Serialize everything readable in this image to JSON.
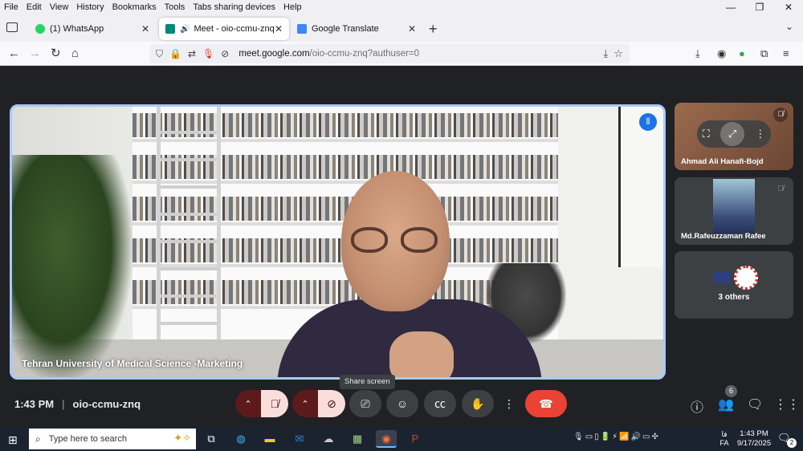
{
  "browser": {
    "menu": [
      "File",
      "Edit",
      "View",
      "History",
      "Bookmarks",
      "Tools",
      "Tabs sharing devices",
      "Help"
    ],
    "window_controls": {
      "minimize": "—",
      "restore": "❐",
      "close": "✕"
    },
    "tabs": [
      {
        "title": "(1) WhatsApp",
        "favicon_color": "#25d366"
      },
      {
        "title": "Meet - oio-ccmu-znq",
        "favicon_color": "#00897b",
        "active": true
      },
      {
        "title": "Google Translate",
        "favicon_color": "#4285f4"
      }
    ],
    "url": {
      "domain": "meet.google.com",
      "path": "/oio-ccmu-znq?authuser=0"
    }
  },
  "meet": {
    "main_speaker": "Tehran University of Medical Science -Marketing",
    "participants": [
      {
        "name": "Ahmad Ali Hanafi-Bojd"
      },
      {
        "name": "Md.Rafeuzzaman Rafee"
      },
      {
        "name": "3 others"
      }
    ],
    "tooltip": "Share screen",
    "time": "1:43 PM",
    "meeting_code": "oio-ccmu-znq",
    "people_count": "6"
  },
  "taskbar": {
    "search_placeholder": "Type here to search",
    "language": {
      "script": "فا",
      "code": "FA"
    },
    "clock": {
      "time": "1:43 PM",
      "date": "9/17/2025"
    },
    "notifications": "2"
  },
  "colors": {
    "meet_bg": "#202124",
    "speaker_border": "#a8c7fa",
    "end_call": "#ea4335",
    "mic_off_bg": "#f9dedc"
  }
}
